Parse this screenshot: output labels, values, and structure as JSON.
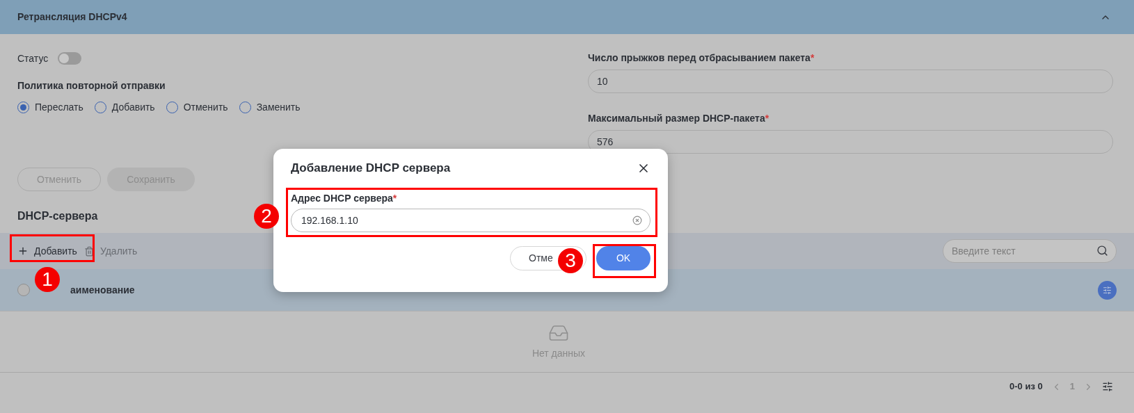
{
  "section": {
    "title": "Ретрансляция DHCPv4",
    "expanded": true
  },
  "status": {
    "label": "Статус",
    "on": false
  },
  "policy": {
    "label": "Политика повторной отправки",
    "options": [
      {
        "label": "Переслать",
        "selected": true
      },
      {
        "label": "Добавить",
        "selected": false
      },
      {
        "label": "Отменить",
        "selected": false
      },
      {
        "label": "Заменить",
        "selected": false
      }
    ]
  },
  "fields": [
    {
      "label": "Число прыжков перед отбрасыванием пакета",
      "required_mark": "*",
      "value": "10"
    },
    {
      "label": "Максимальный размер DHCP-пакета",
      "required_mark": "*",
      "value": "576"
    }
  ],
  "form_buttons": [
    {
      "label": "Отменить",
      "kind": "outline"
    },
    {
      "label": "Сохранить",
      "kind": "filled"
    }
  ],
  "servers": {
    "title": "DHCP-сервера",
    "toolbar": [
      {
        "label": "Добавить",
        "kind": "add",
        "disabled": false
      },
      {
        "label": "Удалить",
        "kind": "delete",
        "disabled": true
      }
    ],
    "search": {
      "placeholder": "Введите текст"
    },
    "select_all": {
      "checked": false
    },
    "columns": [
      {
        "label": "аименование"
      }
    ],
    "empty_text": "Нет данных",
    "pagination": {
      "range": "0-0 из 0",
      "page": "1"
    }
  },
  "dialog": {
    "title": "Добавление DHCP сервера",
    "field": {
      "label": "Адрес DHCP сервера",
      "required_mark": "*",
      "value": "192.168.1.10"
    },
    "buttons": [
      {
        "label": "Отме",
        "kind": "secondary"
      },
      {
        "label": "OK",
        "kind": "primary"
      }
    ]
  },
  "annotations": [
    {
      "label": "1"
    },
    {
      "label": "2"
    },
    {
      "label": "3"
    }
  ]
}
